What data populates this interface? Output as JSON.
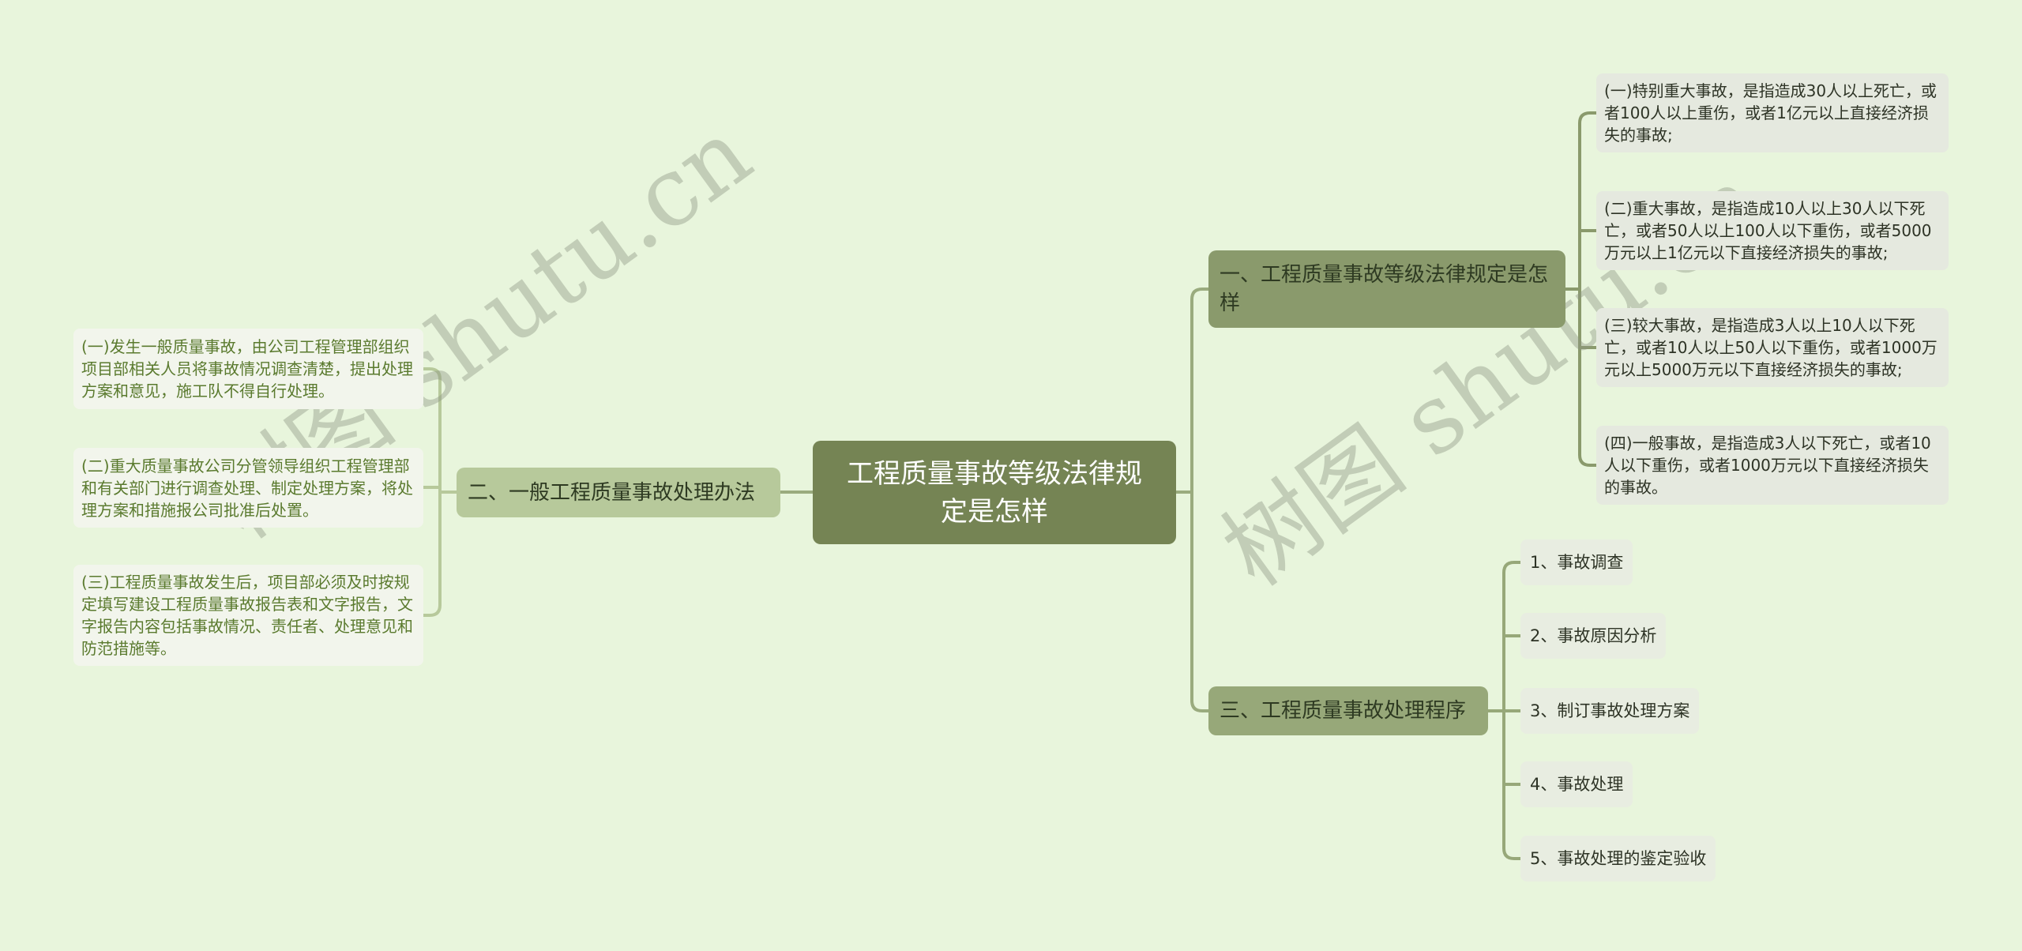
{
  "root": {
    "label": "工程质量事故等级法律规定是怎样"
  },
  "branches": {
    "b1": {
      "label": "一、工程质量事故等级法律规定是怎样",
      "children": [
        "(一)特别重大事故，是指造成30人以上死亡，或者100人以上重伤，或者1亿元以上直接经济损失的事故;",
        "(二)重大事故，是指造成10人以上30人以下死亡，或者50人以上100人以下重伤，或者5000万元以上1亿元以下直接经济损失的事故;",
        "(三)较大事故，是指造成3人以上10人以下死亡，或者10人以上50人以下重伤，或者1000万元以上5000万元以下直接经济损失的事故;",
        "(四)一般事故，是指造成3人以下死亡，或者10人以下重伤，或者1000万元以下直接经济损失的事故。"
      ]
    },
    "b2": {
      "label": "二、一般工程质量事故处理办法",
      "children": [
        "(一)发生一般质量事故，由公司工程管理部组织项目部相关人员将事故情况调查清楚，提出处理方案和意见，施工队不得自行处理。",
        "(二)重大质量事故公司分管领导组织工程管理部和有关部门进行调查处理、制定处理方案，将处理方案和措施报公司批准后处置。",
        "(三)工程质量事故发生后，项目部必须及时按规定填写建设工程质量事故报告表和文字报告，文字报告内容包括事故情况、责任者、处理意见和防范措施等。"
      ]
    },
    "b3": {
      "label": "三、工程质量事故处理程序",
      "children": [
        "1、事故调查",
        "2、事故原因分析",
        "3、制订事故处理方案",
        "4、事故处理",
        "5、事故处理的鉴定验收"
      ]
    }
  },
  "watermark": {
    "text": "树图 shutu.cn"
  },
  "colors": {
    "background": "#e8f5dc",
    "root": "#758454",
    "branch1": "#8a9a6c",
    "branch2": "#b7c99b",
    "branch3": "#97a879",
    "line": "#9aab7e"
  }
}
